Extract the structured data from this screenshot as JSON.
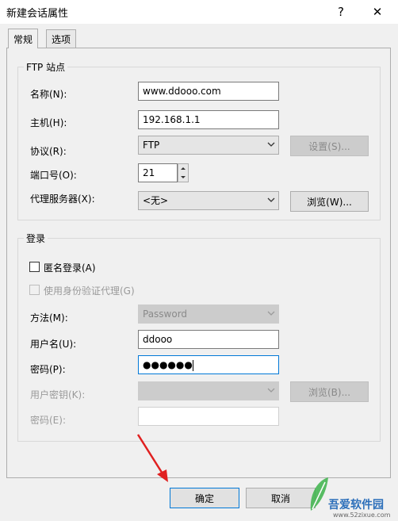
{
  "window": {
    "title": "新建会话属性",
    "help_glyph": "?",
    "close_glyph": "✕"
  },
  "tabs": [
    {
      "label": "常规"
    },
    {
      "label": "选项"
    }
  ],
  "ftp_site": {
    "group_title": "FTP 站点",
    "name_label": "名称(N):",
    "name_value": "www.ddooo.com",
    "host_label": "主机(H):",
    "host_value": "192.168.1.1",
    "protocol_label": "协议(R):",
    "protocol_value": "FTP",
    "settings_button": "设置(S)...",
    "port_label": "端口号(O):",
    "port_value": "21",
    "proxy_label": "代理服务器(X):",
    "proxy_value": "<无>",
    "browse_button": "浏览(W)..."
  },
  "login": {
    "group_title": "登录",
    "anonymous_label": "匿名登录(A)",
    "auth_agent_label": "使用身份验证代理(G)",
    "method_label": "方法(M):",
    "method_value": "Password",
    "username_label": "用户名(U):",
    "username_value": "ddooo",
    "password_label": "密码(P):",
    "password_value": "●●●●●●",
    "user_key_label": "用户密钥(K):",
    "key_browse_button": "浏览(B)...",
    "passphrase_label": "密码(E):"
  },
  "footer": {
    "ok_button": "确定",
    "cancel_button": "取消"
  },
  "watermark": {
    "brand": "吾爱软件园",
    "url": "www.52zixue.com"
  },
  "colors": {
    "accent": "#0078d7",
    "annotation_arrow": "#e02020"
  }
}
